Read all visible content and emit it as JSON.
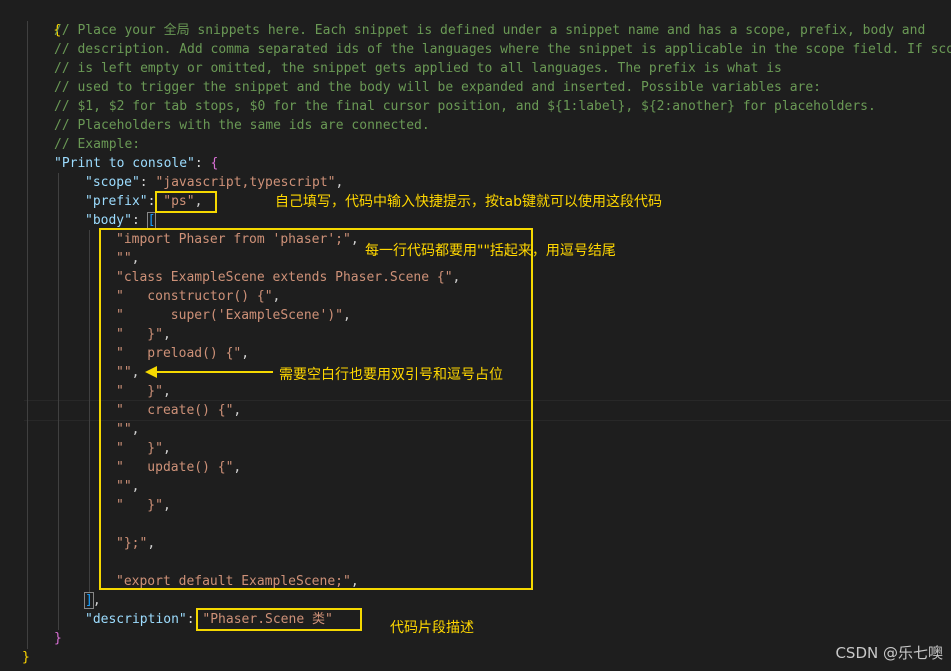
{
  "code": {
    "open_brace": "{",
    "close_brace": "}",
    "comments": [
      "// Place your 全局 snippets here. Each snippet is defined under a snippet name and has a scope, prefix, body and",
      "// description. Add comma separated ids of the languages where the snippet is applicable in the scope field. If scope",
      "// is left empty or omitted, the snippet gets applied to all languages. The prefix is what is",
      "// used to trigger the snippet and the body will be expanded and inserted. Possible variables are:",
      "// $1, $2 for tab stops, $0 for the final cursor position, and ${1:label}, ${2:another} for placeholders.",
      "// Placeholders with the same ids are connected.",
      "// Example:"
    ],
    "snippet_key": "\"Print to console\"",
    "scope_key": "\"scope\"",
    "scope_value": "\"javascript,typescript\"",
    "prefix_key": "\"prefix\"",
    "prefix_value": "\"ps\"",
    "body_key": "\"body\"",
    "body_lines": [
      "\"import Phaser from 'phaser';\"",
      "\"\"",
      "\"class ExampleScene extends Phaser.Scene {\"",
      "\"   constructor() {\"",
      "\"      super('ExampleScene')\"",
      "\"   }\"",
      "\"   preload() {\"",
      "\"\"",
      "\"   }\"",
      "\"   create() {\"",
      "\"\"",
      "\"   }\"",
      "\"   update() {\"",
      "\"\"",
      "\"   }\"",
      "",
      "\"};\"",
      "",
      "\"export default ExampleScene;\""
    ],
    "description_key": "\"description\"",
    "description_value": "\"Phaser.Scene 类\""
  },
  "annotations": {
    "prefix_note": "自己填写，代码中输入快捷提示，按tab键就可以使用这段代码",
    "body_note": "每一行代码都要用\"\"括起来，用逗号结尾",
    "empty_line_note": "需要空白行也要用双引号和逗号占位",
    "description_note": "代码片段描述"
  },
  "watermark": "CSDN @乐七噢",
  "colors": {
    "background": "#1e1e1e",
    "comment": "#6a9955",
    "key": "#9cdcfe",
    "string": "#ce9178",
    "annotation": "#f5d800"
  }
}
